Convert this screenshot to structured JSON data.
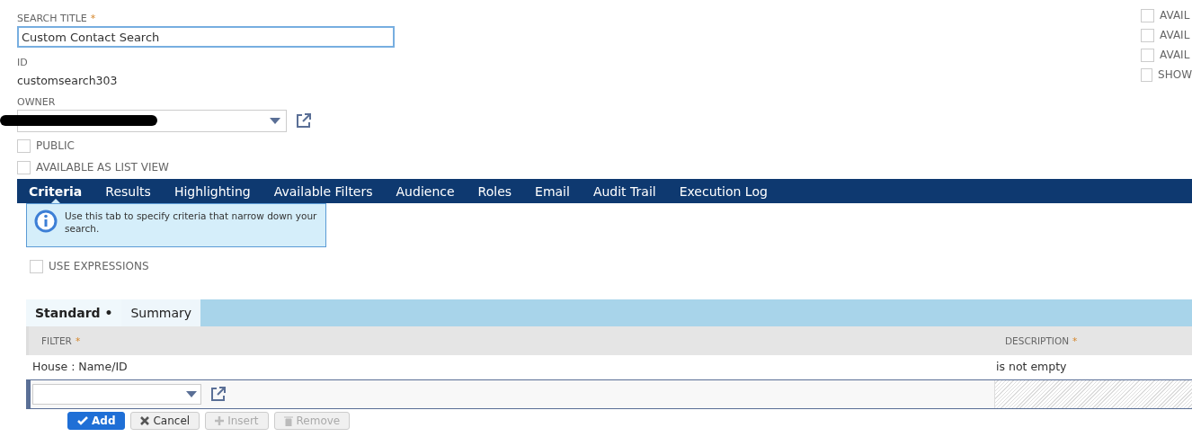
{
  "search_title": {
    "label": "SEARCH TITLE",
    "required_mark": "*",
    "value": "Custom Contact Search"
  },
  "id_field": {
    "label": "ID",
    "value": "customsearch303"
  },
  "owner": {
    "label": "OWNER",
    "redacted": true
  },
  "checkboxes": [
    {
      "label": "PUBLIC",
      "checked": false
    },
    {
      "label": "AVAILABLE AS LIST VIEW",
      "checked": false
    }
  ],
  "right_checkboxes": [
    {
      "label": "AVAIL",
      "checked": false
    },
    {
      "label": "AVAIL",
      "checked": false
    },
    {
      "label": "AVAIL",
      "checked": false
    },
    {
      "label": "SHOW",
      "checked": false
    }
  ],
  "tabs": [
    {
      "label": "Criteria",
      "selected": true
    },
    {
      "label": "Results",
      "selected": false
    },
    {
      "label": "Highlighting",
      "selected": false
    },
    {
      "label": "Available Filters",
      "selected": false
    },
    {
      "label": "Audience",
      "selected": false
    },
    {
      "label": "Roles",
      "selected": false
    },
    {
      "label": "Email",
      "selected": false
    },
    {
      "label": "Audit Trail",
      "selected": false
    },
    {
      "label": "Execution Log",
      "selected": false
    }
  ],
  "info": "Use this tab to specify criteria that narrow down your search.",
  "use_expressions": {
    "label": "USE EXPRESSIONS",
    "checked": false
  },
  "subtabs": [
    {
      "label": "Standard",
      "selected": true,
      "marker": "•"
    },
    {
      "label": "Summary",
      "selected": false
    }
  ],
  "table": {
    "columns": [
      {
        "label": "FILTER",
        "required_mark": "*"
      },
      {
        "label": "DESCRIPTION",
        "required_mark": "*"
      }
    ],
    "rows": [
      [
        "House : Name/ID",
        "is not empty"
      ]
    ]
  },
  "buttons": [
    {
      "label": "Add",
      "kind": "primary",
      "disabled": false
    },
    {
      "label": "Cancel",
      "kind": "cancel",
      "disabled": false
    },
    {
      "label": "Insert",
      "kind": "insert",
      "disabled": true
    },
    {
      "label": "Remove",
      "kind": "remove",
      "disabled": true
    }
  ]
}
